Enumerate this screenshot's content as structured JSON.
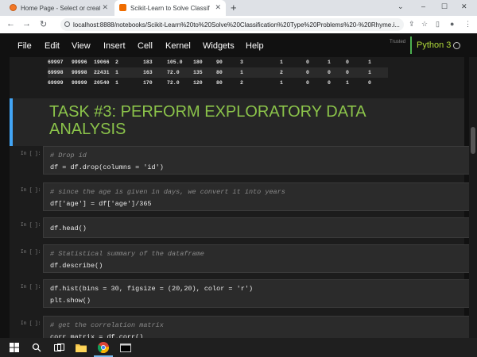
{
  "browser": {
    "tabs": [
      {
        "title": "Home Page - Select or create a notebook"
      },
      {
        "title": "Scikit-Learn to Solve Classification"
      }
    ],
    "new_tab_label": "+",
    "url": "localhost:8888/notebooks/Scikit-Learn%20to%20Solve%20Classification%20Type%20Problems%20-%20Rhyme.i...",
    "window_controls": {
      "collapse": "⌄",
      "minimize": "–",
      "maximize": "☐",
      "close": "✕"
    }
  },
  "jupyter": {
    "menu": [
      "File",
      "Edit",
      "View",
      "Insert",
      "Cell",
      "Kernel",
      "Widgets",
      "Help"
    ],
    "trusted_label": "Trusted",
    "kernel_name": "Python 3"
  },
  "dataframe_rows": [
    [
      "69997",
      "99996",
      "19066",
      "2",
      "183",
      "105.0",
      "180",
      "90",
      "3",
      "1",
      "0",
      "1",
      "0",
      "1"
    ],
    [
      "69998",
      "99998",
      "22431",
      "1",
      "163",
      "72.0",
      "135",
      "80",
      "1",
      "2",
      "0",
      "0",
      "0",
      "1"
    ],
    [
      "69999",
      "99999",
      "20540",
      "1",
      "170",
      "72.0",
      "120",
      "80",
      "2",
      "1",
      "0",
      "0",
      "1",
      "0"
    ]
  ],
  "markdown_title": "TASK #3: PERFORM EXPLORATORY DATA ANALYSIS",
  "cells": [
    {
      "prompt": "In [ ]:",
      "lines": [
        {
          "text": "# Drop id",
          "comment": true
        },
        {
          "text": "df = df.drop(columns = 'id')",
          "comment": false
        }
      ]
    },
    {
      "prompt": "In [ ]:",
      "lines": [
        {
          "text": "# since the age is given in days, we convert it into years",
          "comment": true
        },
        {
          "text": "df['age'] = df['age']/365",
          "comment": false
        }
      ]
    },
    {
      "prompt": "In [ ]:",
      "lines": [
        {
          "text": "df.head()",
          "comment": false
        }
      ]
    },
    {
      "prompt": "In [ ]:",
      "lines": [
        {
          "text": "# Statistical summary of the dataframe",
          "comment": true
        },
        {
          "text": "df.describe()",
          "comment": false
        }
      ]
    },
    {
      "prompt": "In [ ]:",
      "lines": [
        {
          "text": "df.hist(bins = 30, figsize = (20,20), color = 'r')",
          "comment": false
        },
        {
          "text": "plt.show()",
          "comment": false
        }
      ]
    },
    {
      "prompt": "In [ ]:",
      "lines": [
        {
          "text": "# get the correlation matrix",
          "comment": true
        },
        {
          "text": "corr_matrix = df.corr()",
          "comment": false
        }
      ]
    }
  ],
  "taskbar": {
    "icons": [
      "windows-start-icon",
      "search-icon",
      "task-view-icon",
      "file-explorer-icon",
      "chrome-icon",
      "terminal-icon"
    ]
  },
  "colors": {
    "accent_green": "#8bc34a",
    "cell_border_blue": "#42a5f5",
    "kernel_green": "#4caf50"
  }
}
